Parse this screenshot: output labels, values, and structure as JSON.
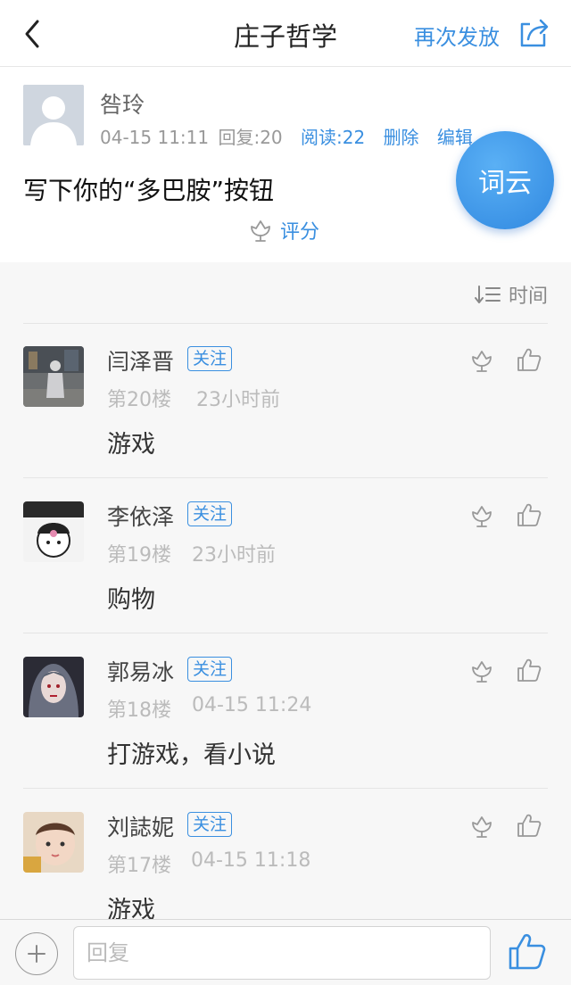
{
  "nav": {
    "title": "庄子哲学",
    "resend_label": "再次发放",
    "back_icon": "chevron-left-icon",
    "share_icon": "share-icon"
  },
  "post": {
    "author": "咎玲",
    "date": "04-15 11:11",
    "replies": "回复:20",
    "reads": "阅读:22",
    "delete_label": "删除",
    "edit_label": "编辑",
    "question": "写下你的“多巴胺”按钮",
    "rate_label": "评分",
    "wordcloud_label": "词云"
  },
  "sort": {
    "label": "时间"
  },
  "comments": [
    {
      "name": "闫泽晋",
      "follow": "关注",
      "floor": "第20楼",
      "time": "23小时前",
      "text": "游戏"
    },
    {
      "name": "李依泽",
      "follow": "关注",
      "floor": "第19楼",
      "time": "23小时前",
      "text": "购物"
    },
    {
      "name": "郭易冰",
      "follow": "关注",
      "floor": "第18楼",
      "time": "04-15 11:24",
      "text": "打游戏，看小说"
    },
    {
      "name": "刘誌妮",
      "follow": "关注",
      "floor": "第17楼",
      "time": "04-15 11:18",
      "text": "游戏"
    }
  ],
  "bottom": {
    "reply_placeholder": "回复"
  },
  "colors": {
    "accent": "#3a8fe0",
    "wordcloud": "#3088e0"
  }
}
